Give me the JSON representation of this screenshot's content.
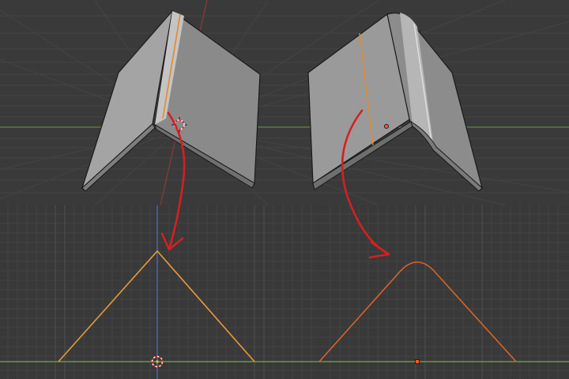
{
  "scene": {
    "colors": {
      "viewport_bg": "#3a3a3a",
      "grid_line": "#444444",
      "grid_line_major": "#4a4a4a",
      "x_axis": "#5a8a3a",
      "y_axis_red": "#8a3a3a",
      "z_axis_blue": "#3a6fbf",
      "mesh_light": "#b8b8b8",
      "mesh_mid": "#8f8f8f",
      "mesh_dark": "#6f6f6f",
      "edge": "#1a1a1a",
      "selected_edge_orange": "#e38a2c",
      "profile_orange": "#e89a3a",
      "profile_red_orange": "#d9622b",
      "annotation_arrow": "#d42020",
      "origin_dot": "#ff5522"
    },
    "icons": {
      "cursor": "3d-cursor-icon",
      "origin": "object-origin-icon"
    }
  },
  "models": [
    {
      "name": "sharp-crease-model",
      "crease": "sharp"
    },
    {
      "name": "beveled-crease-model",
      "crease": "rounded"
    }
  ],
  "profiles": [
    {
      "name": "sharp-peak-profile",
      "peak": "sharp"
    },
    {
      "name": "rounded-peak-profile",
      "peak": "rounded"
    }
  ]
}
